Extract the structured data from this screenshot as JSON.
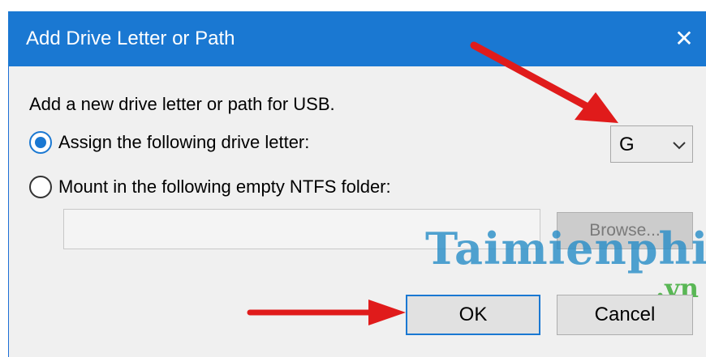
{
  "dialog": {
    "title": "Add Drive Letter or Path",
    "close_glyph": "✕",
    "prompt": "Add a new drive letter or path for USB.",
    "option_assign": {
      "label": "Assign the following drive letter:",
      "checked": true
    },
    "option_mount": {
      "label": "Mount in the following empty NTFS folder:",
      "checked": false
    },
    "drive_letter": {
      "value": "G"
    },
    "folder_path": {
      "value": ""
    },
    "browse_label": "Browse...",
    "ok_label": "OK",
    "cancel_label": "Cancel"
  },
  "watermark": {
    "main": "Taimienphi",
    "sub": ".vn"
  },
  "annotations": {
    "arrow_color": "#e01b1b",
    "icons": [
      "red-arrow-icon",
      "red-arrow-icon"
    ]
  },
  "colors": {
    "accent": "#1a78d2",
    "titlebar": "#1a78d2",
    "dialog_bg": "#f0f0f0"
  }
}
